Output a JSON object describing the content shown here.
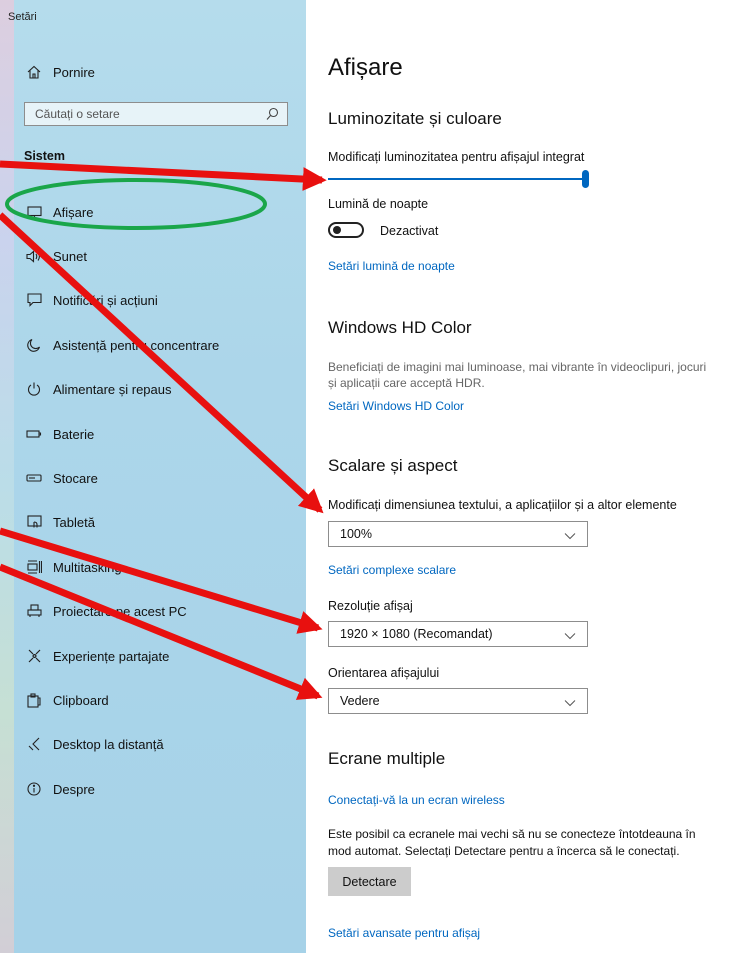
{
  "window": {
    "title": "Setări"
  },
  "sidebar": {
    "home_label": "Pornire",
    "search_placeholder": "Căutați o setare",
    "section_title": "Sistem",
    "items": [
      {
        "label": "Afișare",
        "icon": "monitor-icon"
      },
      {
        "label": "Sunet",
        "icon": "speaker-icon"
      },
      {
        "label": "Notificări și acțiuni",
        "icon": "notification-icon"
      },
      {
        "label": "Asistență pentru concentrare",
        "icon": "moon-icon"
      },
      {
        "label": "Alimentare și repaus",
        "icon": "power-icon"
      },
      {
        "label": "Baterie",
        "icon": "battery-icon"
      },
      {
        "label": "Stocare",
        "icon": "storage-icon"
      },
      {
        "label": "Tabletă",
        "icon": "tablet-icon"
      },
      {
        "label": "Multitasking",
        "icon": "multitasking-icon"
      },
      {
        "label": "Proiectare pe acest PC",
        "icon": "projector-icon"
      },
      {
        "label": "Experiențe partajate",
        "icon": "shared-experiences-icon"
      },
      {
        "label": "Clipboard",
        "icon": "clipboard-icon"
      },
      {
        "label": "Desktop la distanță",
        "icon": "remote-desktop-icon"
      },
      {
        "label": "Despre",
        "icon": "info-icon"
      }
    ]
  },
  "main": {
    "title": "Afișare",
    "brightness": {
      "heading": "Luminozitate și culoare",
      "slider_label": "Modificați luminozitatea pentru afișajul integrat",
      "slider_value": 100,
      "night_light_label": "Lumină de noapte",
      "night_light_state": "Dezactivat",
      "night_light_link": "Setări lumină de noapte"
    },
    "hdr": {
      "heading": "Windows HD Color",
      "description_line1": "Beneficiați de imagini mai luminoase, mai vibrante în videoclipuri, jocuri",
      "description_line2": "și aplicații care acceptă HDR.",
      "link": "Setări Windows HD Color"
    },
    "scale": {
      "heading": "Scalare și aspect",
      "scale_label": "Modificați dimensiunea textului, a aplicațiilor și a altor elemente",
      "scale_value": "100%",
      "advanced_link": "Setări complexe scalare",
      "resolution_label": "Rezoluție afișaj",
      "resolution_value": "1920 × 1080 (Recomandat)",
      "orientation_label": "Orientarea afișajului",
      "orientation_value": "Vedere"
    },
    "multiple": {
      "heading": "Ecrane multiple",
      "wireless_link": "Conectați-vă la un ecran wireless",
      "description_line1": "Este posibil ca ecranele mai vechi să nu se conecteze întotdeauna în",
      "description_line2": "mod automat. Selectați Detectare pentru a încerca să le conectați.",
      "detect_button": "Detectare",
      "advanced_link": "Setări avansate pentru afișaj"
    }
  },
  "annotations": {
    "arrow_color": "#e8100f",
    "ellipse_color": "#1aa64a"
  },
  "colors": {
    "accent": "#0067c0",
    "sidebar_bg": "#acd6ea"
  }
}
